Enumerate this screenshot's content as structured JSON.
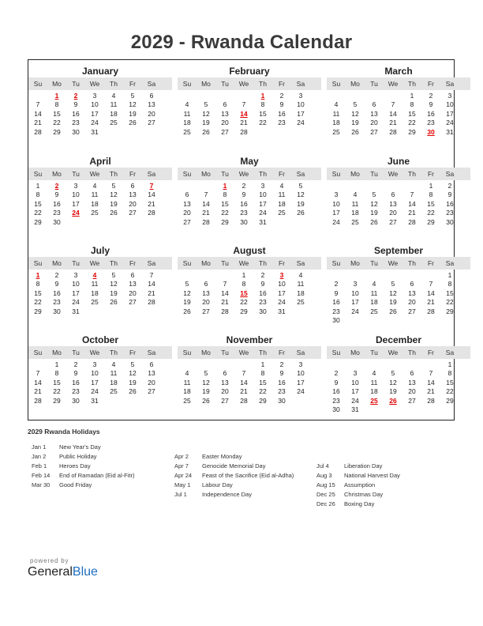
{
  "title": "2029 - Rwanda Calendar",
  "dow": [
    "Su",
    "Mo",
    "Tu",
    "We",
    "Th",
    "Fr",
    "Sa"
  ],
  "months": [
    {
      "name": "January",
      "start": 1,
      "days": 31,
      "holidays": [
        1,
        2
      ]
    },
    {
      "name": "February",
      "start": 4,
      "days": 28,
      "holidays": [
        1,
        14
      ]
    },
    {
      "name": "March",
      "start": 4,
      "days": 31,
      "holidays": [
        30
      ]
    },
    {
      "name": "April",
      "start": 0,
      "days": 30,
      "holidays": [
        2,
        7,
        24
      ]
    },
    {
      "name": "May",
      "start": 2,
      "days": 31,
      "holidays": [
        1
      ]
    },
    {
      "name": "June",
      "start": 5,
      "days": 30,
      "holidays": []
    },
    {
      "name": "July",
      "start": 0,
      "days": 31,
      "holidays": [
        1,
        4
      ]
    },
    {
      "name": "August",
      "start": 3,
      "days": 31,
      "holidays": [
        3,
        15
      ]
    },
    {
      "name": "September",
      "start": 6,
      "days": 30,
      "holidays": []
    },
    {
      "name": "October",
      "start": 1,
      "days": 31,
      "holidays": []
    },
    {
      "name": "November",
      "start": 4,
      "days": 30,
      "holidays": []
    },
    {
      "name": "December",
      "start": 6,
      "days": 31,
      "holidays": [
        25,
        26
      ]
    }
  ],
  "holidays_title": "2029 Rwanda Holidays",
  "holiday_columns": [
    [
      {
        "date": "Jan 1",
        "name": "New Year's Day"
      },
      {
        "date": "Jan 2",
        "name": "Public Holiday"
      },
      {
        "date": "Feb 1",
        "name": "Heroes Day"
      },
      {
        "date": "Feb 14",
        "name": "End of Ramadan (Eid al-Fitr)"
      },
      {
        "date": "Mar 30",
        "name": "Good Friday"
      }
    ],
    [
      {
        "date": "Apr 2",
        "name": "Easter Monday"
      },
      {
        "date": "Apr 7",
        "name": "Genocide Memorial Day"
      },
      {
        "date": "Apr 24",
        "name": "Feast of the Sacrifice (Eid al-Adha)"
      },
      {
        "date": "May 1",
        "name": "Labour Day"
      },
      {
        "date": "Jul 1",
        "name": "Independence Day"
      }
    ],
    [
      {
        "date": "Jul 4",
        "name": "Liberation Day"
      },
      {
        "date": "Aug 3",
        "name": "National Harvest Day"
      },
      {
        "date": "Aug 15",
        "name": "Assumption"
      },
      {
        "date": "Dec 25",
        "name": "Christmas Day"
      },
      {
        "date": "Dec 26",
        "name": "Boxing Day"
      }
    ]
  ],
  "footer": {
    "powered_by": "powered by",
    "brand_general": "General",
    "brand_blue": "Blue"
  },
  "colors": {
    "holiday": "#e00000",
    "header_bg": "#e4e4e4",
    "brand_blue": "#1e6fc0"
  }
}
